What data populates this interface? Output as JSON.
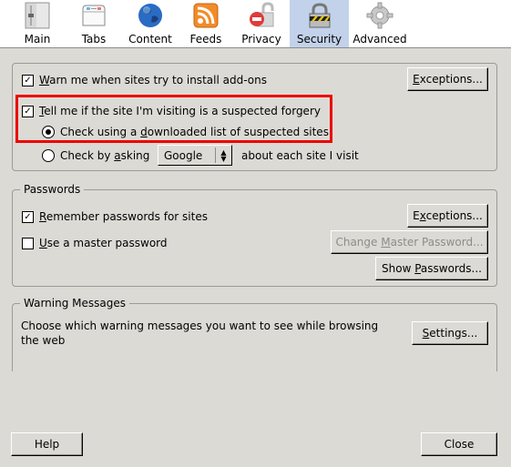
{
  "toolbar": {
    "tabs": [
      {
        "label": "Main",
        "icon": "main-sliders-icon",
        "selected": false
      },
      {
        "label": "Tabs",
        "icon": "tabs-icon",
        "selected": false
      },
      {
        "label": "Content",
        "icon": "globe-icon",
        "selected": false
      },
      {
        "label": "Feeds",
        "icon": "rss-feed-icon",
        "selected": false
      },
      {
        "label": "Privacy",
        "icon": "privacy-lock-icon",
        "selected": false
      },
      {
        "label": "Security",
        "icon": "security-padlock-icon",
        "selected": true
      },
      {
        "label": "Advanced",
        "icon": "gear-icon",
        "selected": false
      }
    ],
    "selected_bg": "#c2d2ea"
  },
  "general": {
    "warn_addons": {
      "pre": "",
      "accel": "W",
      "post": "arn me when sites try to install add-ons",
      "checked": true
    },
    "exceptions_button": {
      "pre": "",
      "accel": "E",
      "post": "xceptions..."
    },
    "forgery": {
      "pre": "",
      "accel": "T",
      "post": "ell me if the site I'm visiting is a suspected forgery",
      "checked": true
    },
    "radio_downloaded": {
      "pre": "Check using a ",
      "accel": "d",
      "post": "ownloaded list of suspected sites",
      "selected": true
    },
    "radio_asking": {
      "pre": "Check by ",
      "accel": "a",
      "post": "sking",
      "selected": false
    },
    "provider_select": {
      "value": "Google"
    },
    "asking_suffix": "about each site I visit",
    "highlight_color": "#ee0000"
  },
  "passwords": {
    "legend": "Passwords",
    "remember": {
      "pre": "",
      "accel": "R",
      "post": "emember passwords for sites",
      "checked": true
    },
    "master": {
      "pre": "",
      "accel": "U",
      "post": "se a master password",
      "checked": false
    },
    "exceptions_button": {
      "pre": "E",
      "accel": "x",
      "post": "ceptions..."
    },
    "change_master_button": {
      "pre": "Change ",
      "accel": "M",
      "post": "aster Password...",
      "disabled": true
    },
    "show_passwords_button": {
      "pre": "Show ",
      "accel": "P",
      "post": "asswords..."
    }
  },
  "warnings": {
    "legend": "Warning Messages",
    "description": "Choose which warning messages you want to see while browsing the web",
    "settings_button": {
      "pre": "",
      "accel": "S",
      "post": "ettings..."
    }
  },
  "footer": {
    "help_label": "Help",
    "close_label": "Close"
  }
}
